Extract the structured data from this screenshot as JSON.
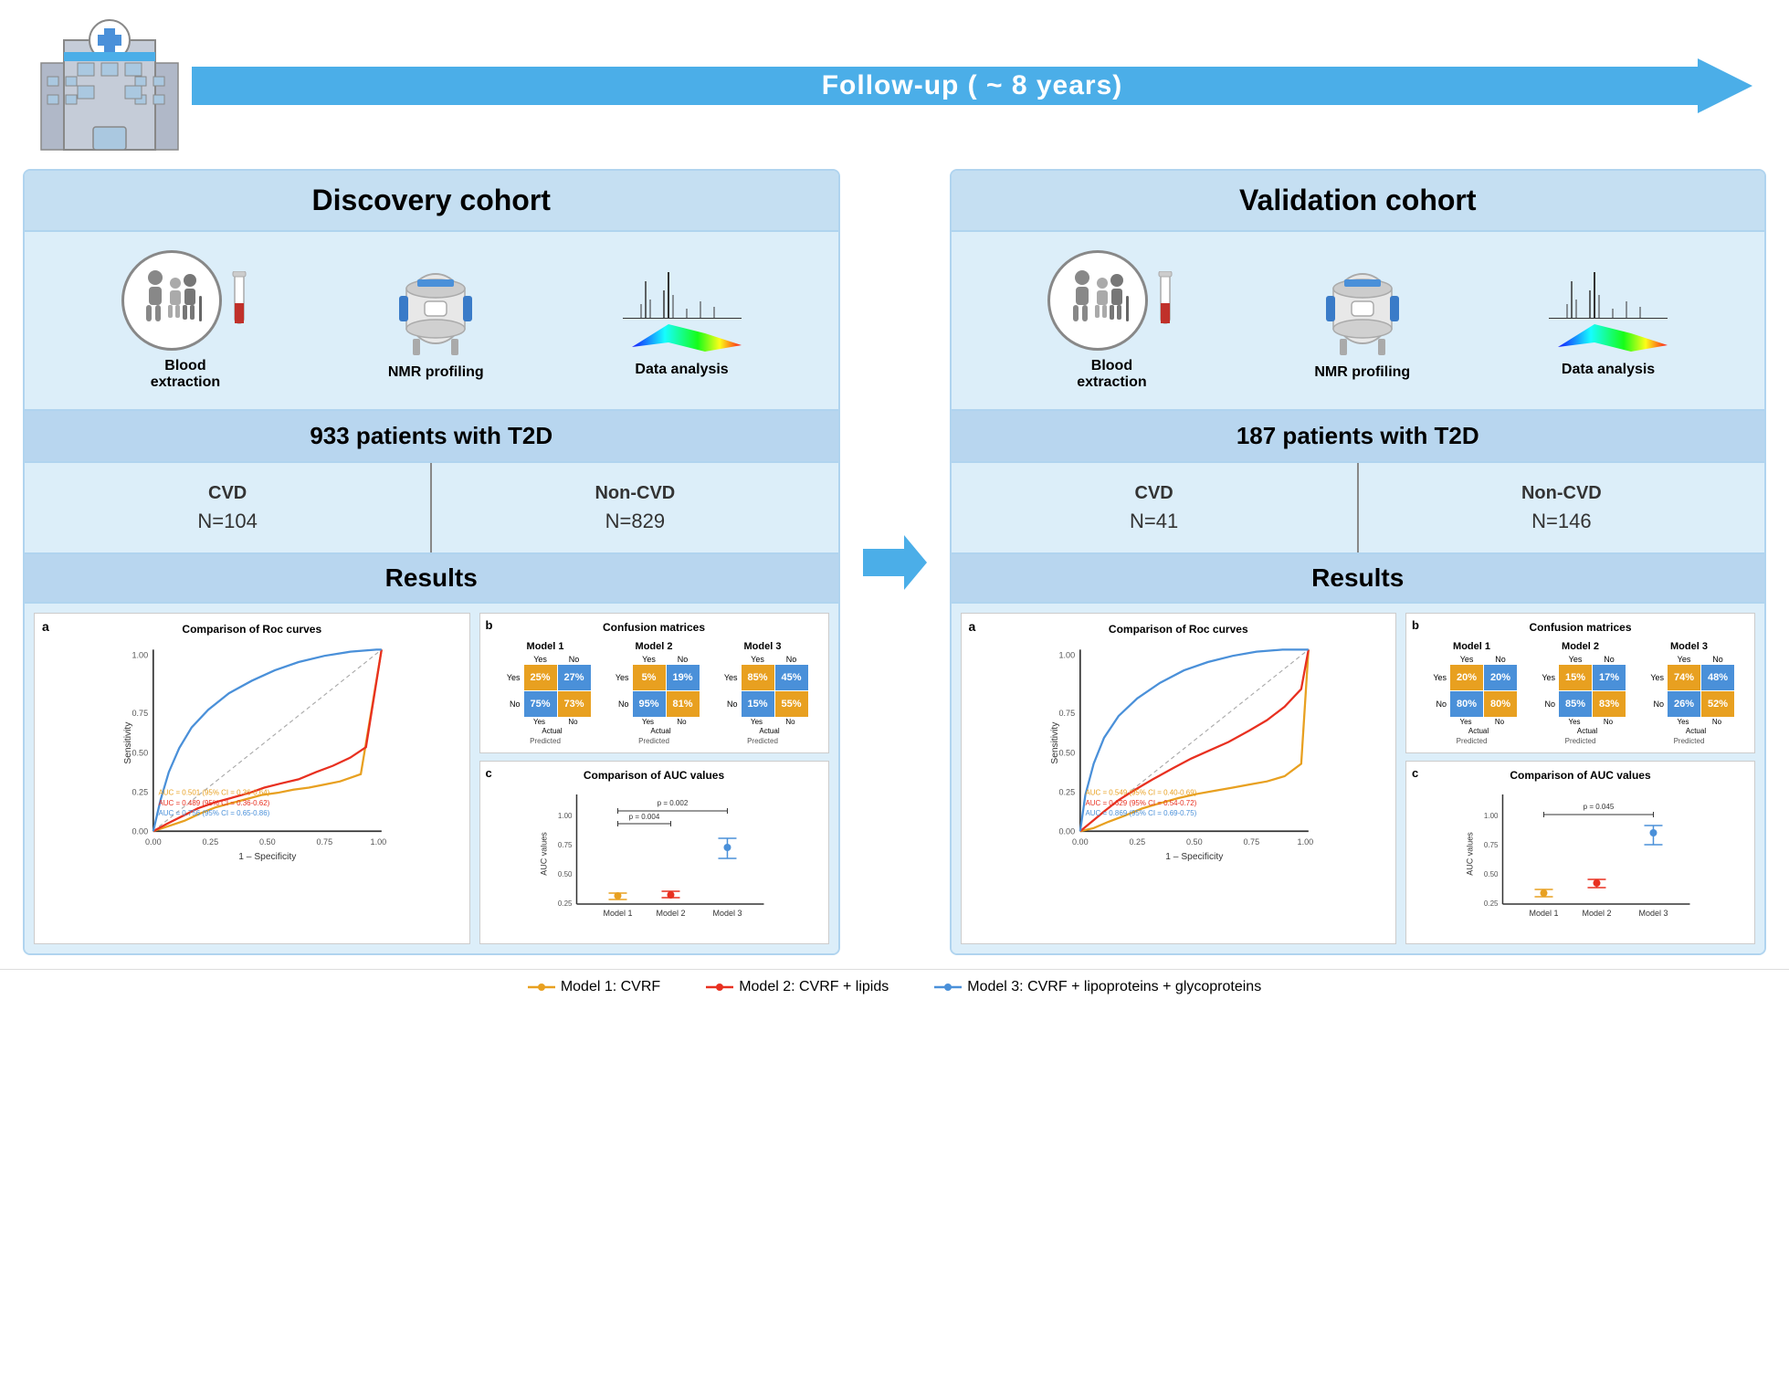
{
  "followup": {
    "text": "Follow-up ( ~ 8 years)"
  },
  "discovery": {
    "title": "Discovery cohort",
    "bloodExtraction": "Blood extraction",
    "nmrProfiling": "NMR profiling",
    "dataAnalysis": "Data analysis",
    "patientsCount": "933 patients with T2D",
    "cvd": "CVD",
    "nonCvd": "Non-CVD",
    "nCvd": "N=104",
    "nNonCvd": "N=829",
    "results": "Results",
    "rocTitle": "Comparison of Roc curves",
    "confTitle": "Confusion matrices",
    "aucTitle": "Comparison of AUC values",
    "panelA": "a",
    "panelB": "b",
    "panelC": "c",
    "aucLines": [
      "AUC = 0.501 (95% CI = 0.36-0.64)",
      "AUC = 0.489 (95% CI = 0.36-0.62)",
      "AUC = 0.756 (95% CI = 0.65-0.86)"
    ],
    "confMatrices": {
      "model1": {
        "title": "Model 1",
        "cells": [
          "25%",
          "27%",
          "75%",
          "73%"
        ],
        "colors": [
          "orange",
          "blue",
          "blue",
          "orange"
        ],
        "yesNo": [
          "Yes",
          "No"
        ],
        "actualLabels": [
          "Yes",
          "No"
        ]
      },
      "model2": {
        "title": "Model 2",
        "cells": [
          "5%",
          "19%",
          "95%",
          "81%"
        ],
        "colors": [
          "orange",
          "blue",
          "blue",
          "orange"
        ],
        "yesNo": [
          "Yes",
          "No"
        ],
        "actualLabels": [
          "Yes",
          "No"
        ]
      },
      "model3": {
        "title": "Model 3",
        "cells": [
          "85%",
          "45%",
          "15%",
          "55%"
        ],
        "colors": [
          "orange",
          "blue",
          "blue",
          "orange"
        ],
        "yesNo": [
          "Yes",
          "No"
        ],
        "actualLabels": [
          "Yes",
          "No"
        ]
      }
    },
    "pValue1": "p = 0.004",
    "pValue2": "p = 0.002",
    "sensitivityLabel": "Sensitivity",
    "specificityLabel": "1 – Specificity",
    "aucValuesLabel": "AUC values",
    "modelLabels": [
      "Model 1",
      "Model 2",
      "Model 3"
    ]
  },
  "validation": {
    "title": "Validation cohort",
    "bloodExtraction": "Blood extraction",
    "nmrProfiling": "NMR profiling",
    "dataAnalysis": "Data analysis",
    "patientsCount": "187 patients with T2D",
    "cvd": "CVD",
    "nonCvd": "Non-CVD",
    "nCvd": "N=41",
    "nNonCvd": "N=146",
    "results": "Results",
    "rocTitle": "Comparison of Roc curves",
    "confTitle": "Confusion matrices",
    "aucTitle": "Comparison of AUC values",
    "panelA": "a",
    "panelB": "b",
    "panelC": "c",
    "aucLines": [
      "AUC = 0.549 (95% CI = 0.40-0.69)",
      "AUC = 0.629 (95% CI = 0.54-0.72)",
      "AUC = 0.869 (95% CI = 0.69-0.75)"
    ],
    "confMatrices": {
      "model1": {
        "title": "Model 1",
        "cells": [
          "20%",
          "20%",
          "80%",
          "80%"
        ],
        "colors": [
          "orange",
          "blue",
          "blue",
          "orange"
        ]
      },
      "model2": {
        "title": "Model 2",
        "cells": [
          "15%",
          "17%",
          "85%",
          "83%"
        ],
        "colors": [
          "orange",
          "blue",
          "blue",
          "orange"
        ]
      },
      "model3": {
        "title": "Model 3",
        "cells": [
          "74%",
          "48%",
          "26%",
          "52%"
        ],
        "colors": [
          "orange",
          "blue",
          "blue",
          "orange"
        ]
      }
    },
    "pValue1": "p = 0.045",
    "sensitivityLabel": "Sensitivity",
    "specificityLabel": "1 – Specificity",
    "aucValuesLabel": "AUC values",
    "modelLabels": [
      "Model 1",
      "Model 2",
      "Model 3"
    ]
  },
  "legend": {
    "model1": "Model 1: CVRF",
    "model2": "Model 2: CVRF + lipids",
    "model3": "Model 3: CVRF + lipoproteins + glycoproteins"
  },
  "colors": {
    "orange": "#e8a020",
    "red": "#e83020",
    "blue": "#4a90d9",
    "lightBlue": "#4baee8",
    "panelBg": "#dceef9",
    "panelHeader": "#c5dff2",
    "bandBg": "#b8d6ef"
  }
}
